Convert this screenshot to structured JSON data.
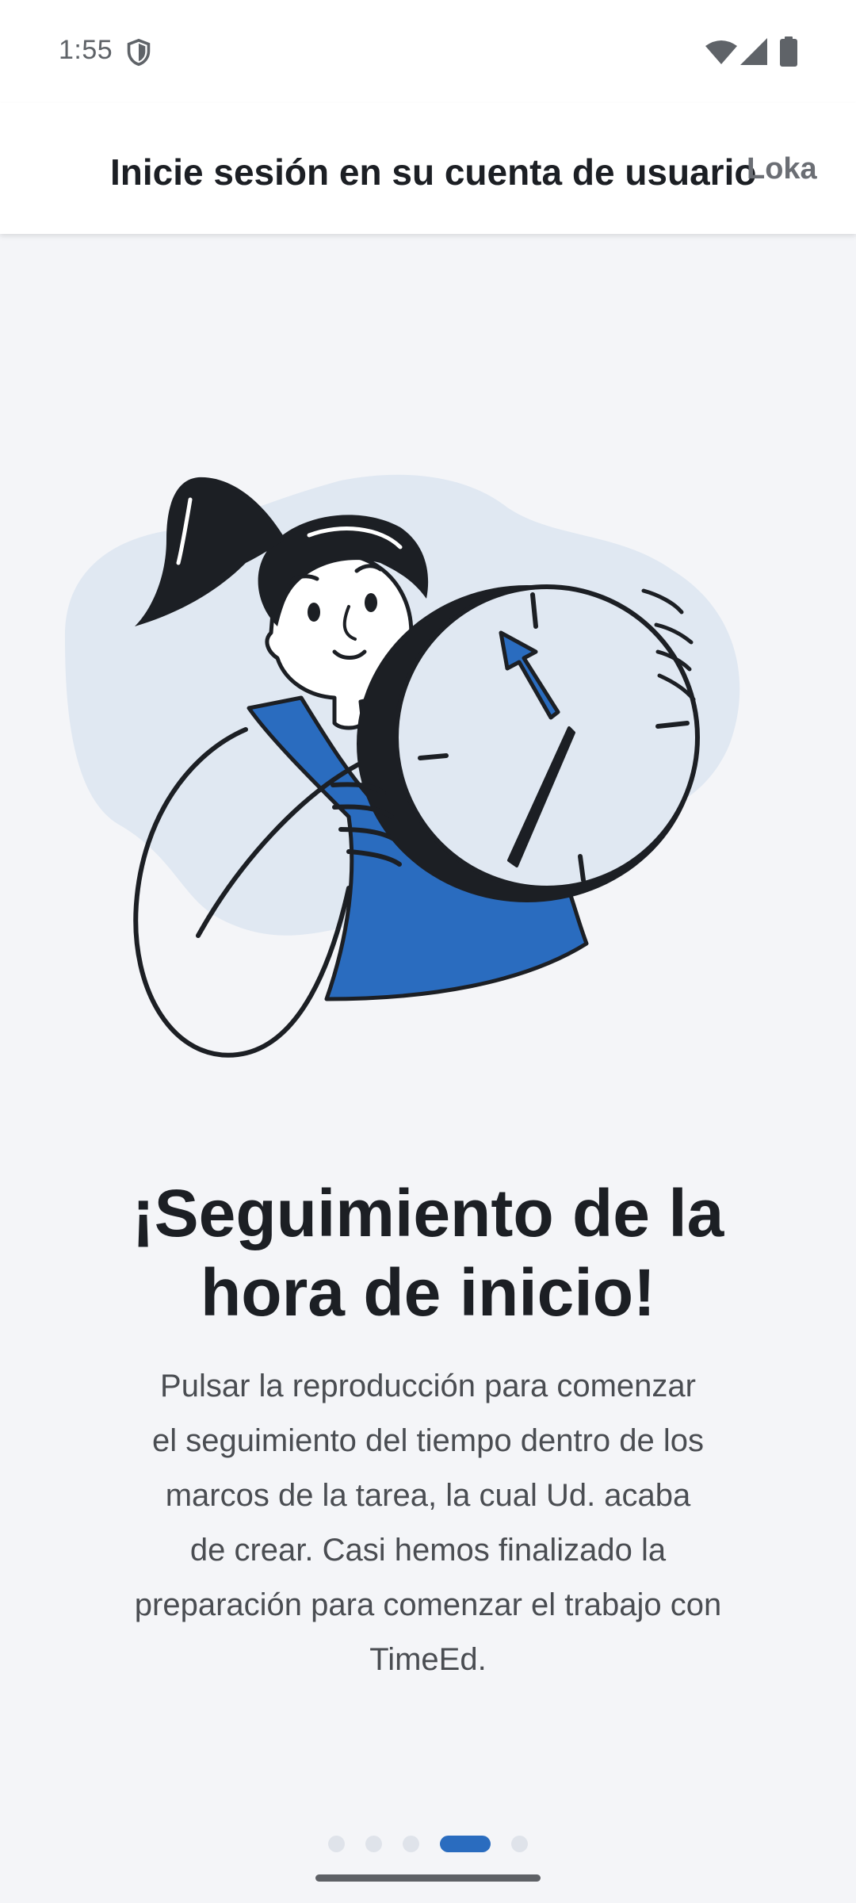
{
  "status_bar": {
    "time": "1:55",
    "icons": [
      "shield-icon",
      "wifi-icon",
      "signal-icon",
      "battery-icon"
    ]
  },
  "header": {
    "title": "Inicie sesión en su cuenta de usuario",
    "skip_label": "Loka"
  },
  "illustration": {
    "subject": "woman-holding-clock-illustration",
    "colors": {
      "accent": "#2a6cbf",
      "blob": "#e0e8f2",
      "ink": "#1c1f24"
    }
  },
  "slide": {
    "title_line1": "¡Seguimiento de la",
    "title_line2": "hora de inicio!",
    "body_lines": [
      "Pulsar la reproducción para comenzar",
      "el seguimiento del tiempo dentro de los",
      "marcos de la tarea, la cual Ud. acaba",
      "de crear. Casi hemos finalizado la",
      "preparación para comenzar el trabajo con",
      "TimeEd."
    ]
  },
  "pager": {
    "count": 5,
    "active_index": 3,
    "active_color": "#2a6cbf",
    "inactive_color": "#dfe3ea"
  }
}
